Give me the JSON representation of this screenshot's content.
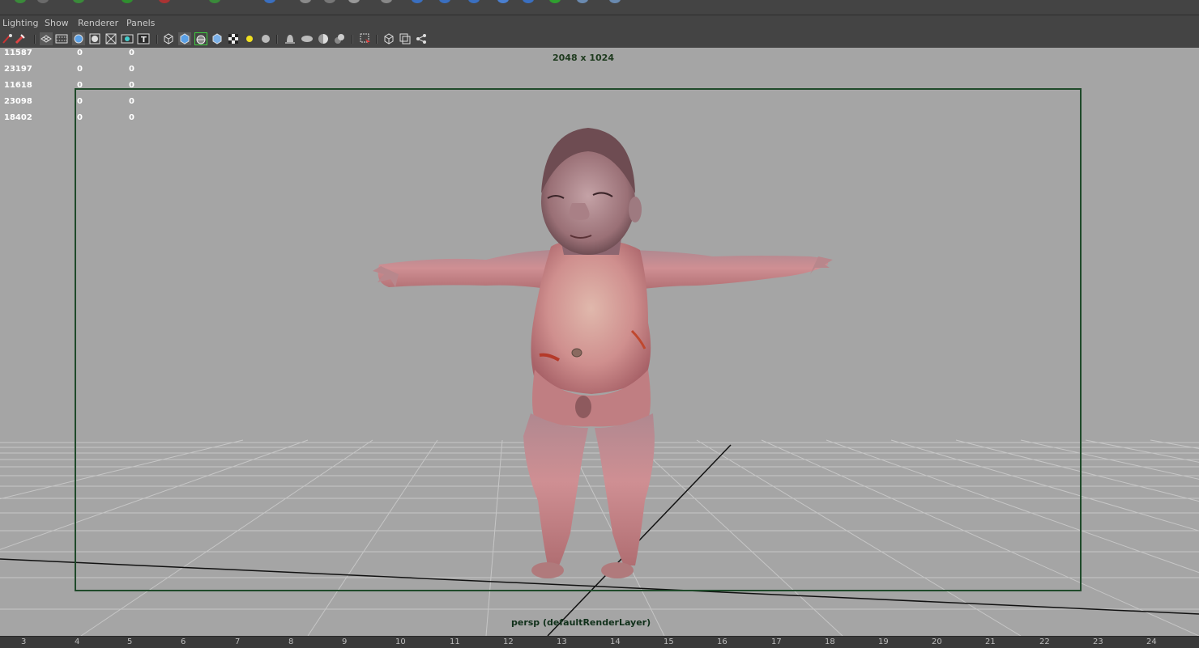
{
  "menu": {
    "items": [
      "Lighting",
      "Show",
      "Renderer",
      "Panels"
    ]
  },
  "toolbar": {
    "icons": [
      "camera-select-icon",
      "camera-attributes-icon",
      "grid-toggle-icon",
      "film-gate-icon",
      "resolution-gate-icon",
      "gate-mask-icon",
      "field-chart-icon",
      "safe-action-icon",
      "safe-title-icon",
      "wireframe-icon",
      "smooth-shade-icon",
      "wireframe-on-shaded-icon",
      "textured-icon",
      "use-all-lights-icon",
      "use-default-light-icon",
      "shadows-icon",
      "screen-space-ao-icon",
      "motion-blur-icon",
      "multisample-aa-icon",
      "depth-of-field-icon",
      "isolate-select-icon",
      "xray-icon",
      "xray-active-icon",
      "xray-joints-icon"
    ]
  },
  "hud": {
    "rows": [
      [
        "11587",
        "0",
        "0"
      ],
      [
        "23197",
        "0",
        "0"
      ],
      [
        "11618",
        "0",
        "0"
      ],
      [
        "23098",
        "0",
        "0"
      ],
      [
        "18402",
        "0",
        "0"
      ]
    ]
  },
  "viewport": {
    "resolution": "2048 x 1024",
    "camera_label": "persp (defaultRenderLayer)",
    "background_color": "#a5a5a5",
    "grid_color": "#c6c6c6",
    "gate_color": "#1f4a2a"
  },
  "timeline": {
    "ticks": [
      "3",
      "4",
      "5",
      "6",
      "7",
      "8",
      "9",
      "10",
      "11",
      "12",
      "13",
      "14",
      "15",
      "16",
      "17",
      "18",
      "19",
      "20",
      "21",
      "22",
      "23",
      "24"
    ]
  }
}
